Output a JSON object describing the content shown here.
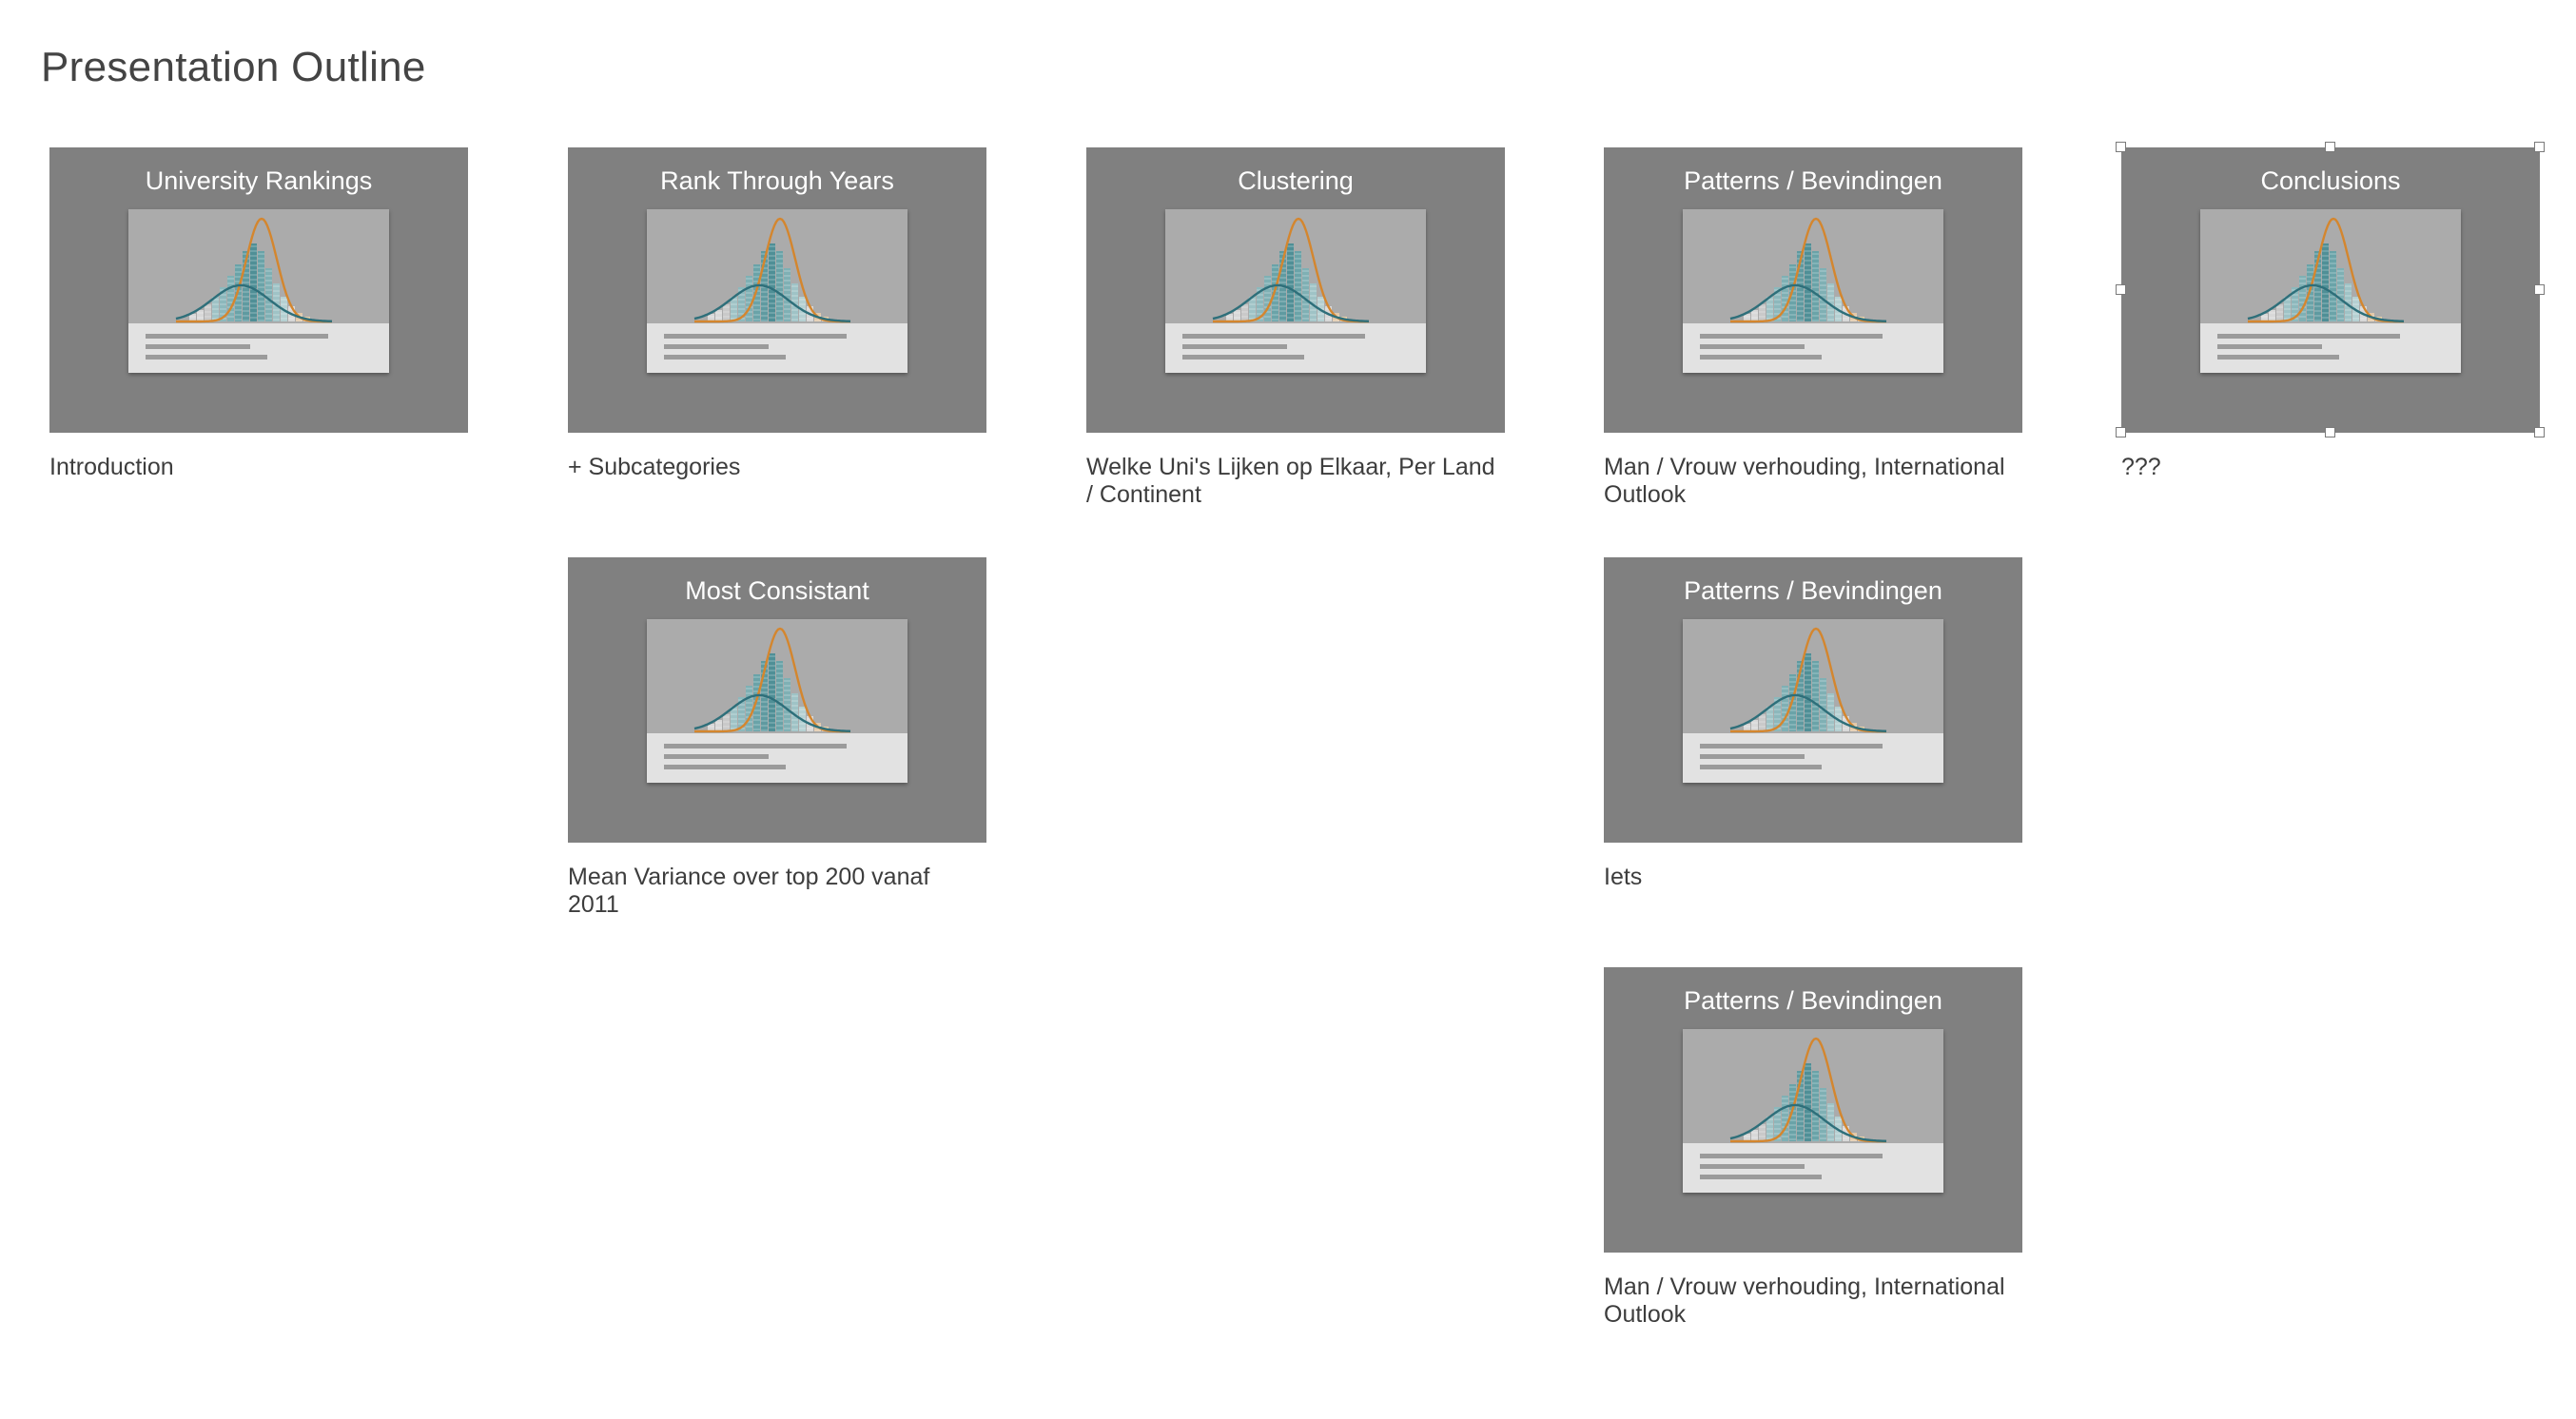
{
  "title": "Presentation Outline",
  "cards": [
    {
      "title": "University Rankings",
      "caption": "Introduction"
    },
    {
      "title": "Rank Through Years",
      "caption": "+ Subcategories"
    },
    {
      "title": "Clustering",
      "caption": "Welke Uni's Lijken op Elkaar, Per Land / Continent"
    },
    {
      "title": "Patterns / Bevindingen",
      "caption": "Man / Vrouw verhouding, International Outlook"
    },
    {
      "title": "Conclusions",
      "caption": "???"
    },
    {
      "title": "Most Consistant",
      "caption": "Mean Variance over top 200 vanaf 2011"
    },
    {
      "title": "Patterns / Bevindingen",
      "caption": "Iets"
    },
    {
      "title": "Patterns / Bevindingen",
      "caption": "Man / Vrouw verhouding, International Outlook"
    }
  ],
  "colors": {
    "card_bg": "#808080",
    "curve_teal": "#2e6f7a",
    "curve_orange": "#d4862e"
  }
}
